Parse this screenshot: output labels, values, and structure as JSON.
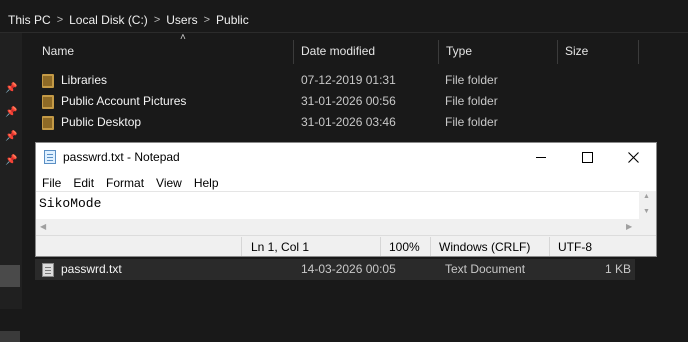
{
  "breadcrumb": [
    "This PC",
    "Local Disk (C:)",
    "Users",
    "Public"
  ],
  "breadcrumb_separator": ">",
  "columns": {
    "name": "Name",
    "date": "Date modified",
    "type": "Type",
    "size": "Size"
  },
  "rows": [
    {
      "name": "Libraries",
      "date": "07-12-2019 01:31",
      "type": "File folder",
      "size": "",
      "icon": "folder-icon"
    },
    {
      "name": "Public Account Pictures",
      "date": "31-01-2026 00:56",
      "type": "File folder",
      "size": "",
      "icon": "folder-icon"
    },
    {
      "name": "Public Desktop",
      "date": "31-01-2026 03:46",
      "type": "File folder",
      "size": "",
      "icon": "folder-icon"
    },
    {
      "name": "passwrd.txt",
      "date": "14-03-2026 00:05",
      "type": "Text Document",
      "size": "1 KB",
      "icon": "text-file-icon"
    }
  ],
  "notepad": {
    "title": "passwrd.txt - Notepad",
    "menu": [
      "File",
      "Edit",
      "Format",
      "View",
      "Help"
    ],
    "content": "SikoMode",
    "status": {
      "position": "Ln 1, Col 1",
      "zoom": "100%",
      "line_ending": "Windows (CRLF)",
      "encoding": "UTF-8"
    }
  }
}
